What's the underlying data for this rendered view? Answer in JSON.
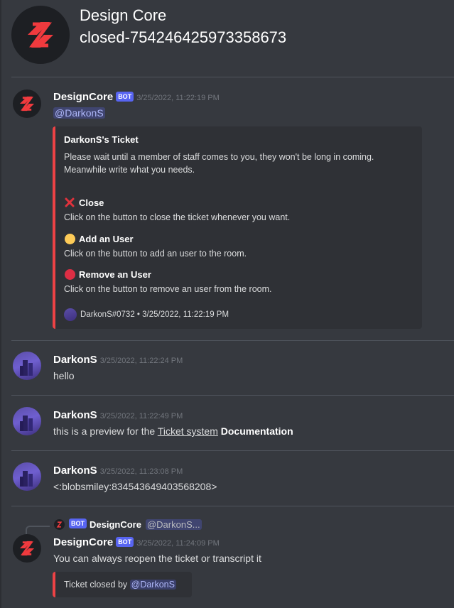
{
  "header": {
    "guild_name": "Design Core",
    "channel_name": "closed-754246425973358673"
  },
  "colors": {
    "accent_red": "#ed4245",
    "bot_tag": "#5865f2",
    "background": "#36393f",
    "embed_bg": "#2f3136"
  },
  "messages": [
    {
      "author": "DesignCore",
      "bot_tag": "BOT",
      "timestamp": "3/25/2022, 11:22:19 PM",
      "mention": "@DarkonS",
      "embed": {
        "title": "DarkonS's Ticket",
        "description": "Please wait until a member of staff comes to you, they won't be long in coming. Meanwhile write what you needs.",
        "fields": [
          {
            "icon": "cross-mark-icon",
            "name": "Close",
            "value": "Click on the button to close the ticket whenever you want."
          },
          {
            "icon": "yellow-circle-icon",
            "name": "Add an User",
            "value": "Click on the button to add an user to the room."
          },
          {
            "icon": "red-circle-icon",
            "name": "Remove an User",
            "value": "Click on the button to remove an user from the room."
          }
        ],
        "footer": "DarkonS#0732 • 3/25/2022, 11:22:19 PM"
      }
    },
    {
      "author": "DarkonS",
      "timestamp": "3/25/2022, 11:22:24 PM",
      "content": "hello"
    },
    {
      "author": "DarkonS",
      "timestamp": "3/25/2022, 11:22:49 PM",
      "content_prefix": "this is a preview for the ",
      "content_link": "Ticket system",
      "content_bold": "Documentation"
    },
    {
      "author": "DarkonS",
      "timestamp": "3/25/2022, 11:23:08 PM",
      "content": "<:blobsmiley:834543649403568208>"
    },
    {
      "reply": {
        "bot_tag": "BOT",
        "author": "DesignCore",
        "content": "@DarkonS..."
      },
      "author": "DesignCore",
      "bot_tag": "BOT",
      "timestamp": "3/25/2022, 11:24:09 PM",
      "content": "You can always reopen the ticket or transcript it",
      "embed": {
        "text": "Ticket closed by",
        "mention": "@DarkonS"
      }
    }
  ]
}
